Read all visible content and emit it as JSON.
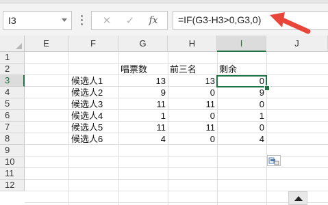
{
  "name_box": {
    "value": "I3"
  },
  "formula_bar": {
    "cancel_icon": "close-icon",
    "enter_icon": "check-icon",
    "fx_label": "fx",
    "formula": "=IF(G3-H3>0,G3,0)"
  },
  "columns": [
    "E",
    "F",
    "G",
    "H",
    "I",
    "J"
  ],
  "rows": [
    "1",
    "2",
    "3",
    "4",
    "5",
    "6",
    "7",
    "8",
    "9",
    "10",
    "11",
    "12"
  ],
  "selected_cell": {
    "column": "I",
    "row": "3"
  },
  "headers": {
    "G": "唱票数",
    "H": "前三名",
    "I": "剩余"
  },
  "table": [
    {
      "name": "候选人1",
      "votes": "13",
      "top3": "13",
      "rest": "0"
    },
    {
      "name": "候选人2",
      "votes": "9",
      "top3": "0",
      "rest": "9"
    },
    {
      "name": "候选人3",
      "votes": "11",
      "top3": "11",
      "rest": "0"
    },
    {
      "name": "候选人4",
      "votes": "1",
      "top3": "0",
      "rest": "1"
    },
    {
      "name": "候选人5",
      "votes": "11",
      "top3": "11",
      "rest": "0"
    },
    {
      "name": "候选人6",
      "votes": "4",
      "top3": "0",
      "rest": "4"
    }
  ],
  "colors": {
    "accent": "#217346",
    "annotation_arrow": "#e8463a"
  }
}
